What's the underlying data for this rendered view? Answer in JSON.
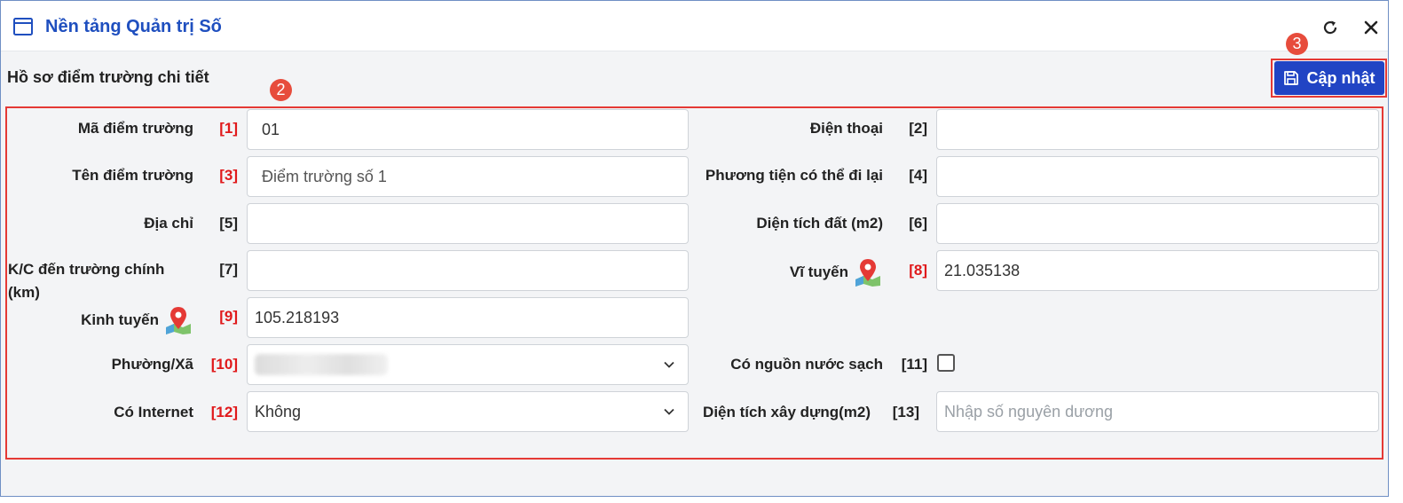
{
  "window": {
    "title": "Nền tảng Quản trị Số",
    "icons": {
      "app": "window-icon",
      "refresh": "refresh-icon",
      "close": "close-icon"
    }
  },
  "section": {
    "title": "Hồ sơ điểm trường chi tiết"
  },
  "badges": {
    "form": "2",
    "update": "3"
  },
  "toolbar": {
    "update_label": "Cập nhật",
    "update_icon": "save-icon"
  },
  "colors": {
    "accent": "#2144c4",
    "title": "#1f4fbf",
    "required": "#e0191b",
    "highlight": "#e53935"
  },
  "form": {
    "ma_diem_truong": {
      "label": "Mã điểm trường",
      "num": "[1]",
      "value": "01"
    },
    "dien_thoai": {
      "label": "Điện thoại",
      "num": "[2]",
      "value": ""
    },
    "ten_diem_truong": {
      "label": "Tên điểm trường",
      "num": "[3]",
      "value": "Điểm trường số 1"
    },
    "phuong_tien": {
      "label": "Phương tiện có thể đi lại",
      "num": "[4]",
      "value": ""
    },
    "dia_chi": {
      "label": "Địa chỉ",
      "num": "[5]",
      "value": ""
    },
    "dien_tich_dat": {
      "label": "Diện tích đất (m2)",
      "num": "[6]",
      "value": ""
    },
    "kc_truong_chinh": {
      "label_line1": "K/C đến trường chính",
      "label_line2": "(km)",
      "num": "[7]",
      "value": ""
    },
    "vi_tuyen": {
      "label": "Vĩ tuyến",
      "num": "[8]",
      "value": "21.035138",
      "icon": "map-pin-icon"
    },
    "kinh_tuyen": {
      "label": "Kinh tuyến",
      "num": "[9]",
      "value": "105.218193",
      "icon": "map-pin-icon"
    },
    "phuong_xa": {
      "label": "Phường/Xã",
      "num": "[10]"
    },
    "nuoc_sach": {
      "label": "Có nguồn nước sạch",
      "num": "[11]",
      "checked": false
    },
    "internet": {
      "label": "Có Internet",
      "num": "[12]",
      "value": "Không"
    },
    "dien_tich_xay_dung": {
      "label": "Diện tích xây dựng(m2)",
      "num": "[13]",
      "placeholder": "Nhập số nguyên dương"
    }
  }
}
